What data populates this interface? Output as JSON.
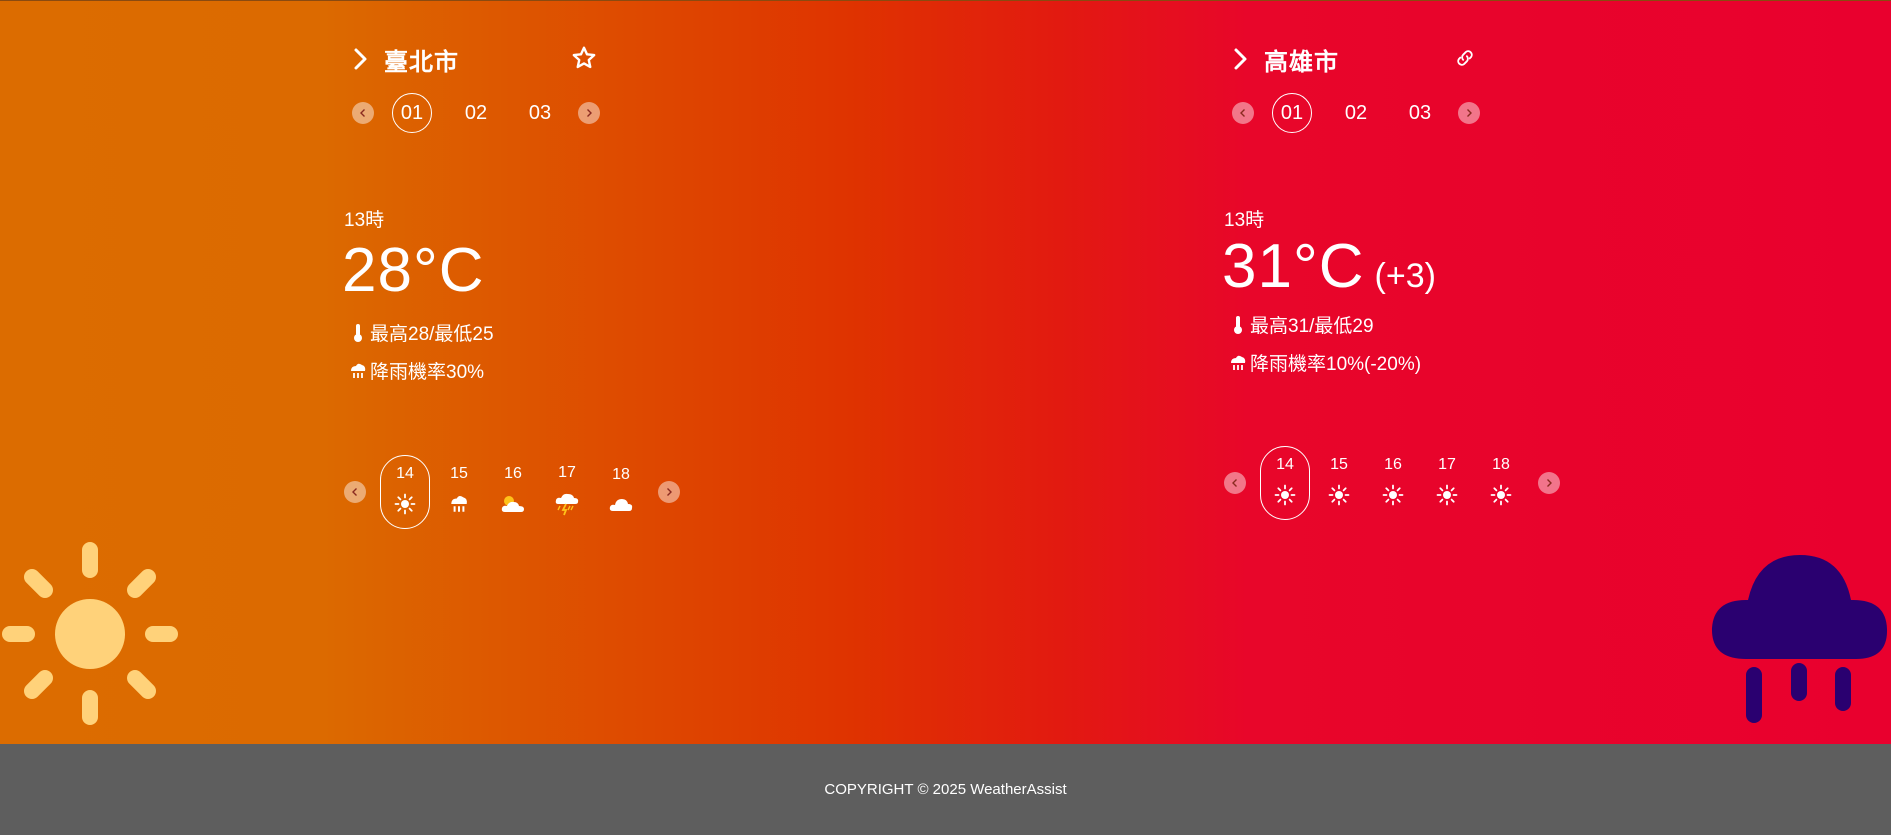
{
  "panels": [
    {
      "city": "臺北市",
      "action_icon": "star-icon",
      "day_tabs": [
        "01",
        "02",
        "03"
      ],
      "active_day": 0,
      "hour": "13時",
      "temperature": "28°C",
      "temp_delta": "",
      "high_low": "最高28/最低25",
      "rain_chance": "降雨機率30%",
      "hourly": [
        {
          "hour": "14",
          "icon": "sunny-icon"
        },
        {
          "hour": "15",
          "icon": "rain-icon"
        },
        {
          "hour": "16",
          "icon": "partly-cloudy-icon"
        },
        {
          "hour": "17",
          "icon": "thunderstorm-icon"
        },
        {
          "hour": "18",
          "icon": "cloudy-icon"
        }
      ],
      "active_hour": 0
    },
    {
      "city": "高雄市",
      "action_icon": "link-icon",
      "day_tabs": [
        "01",
        "02",
        "03"
      ],
      "active_day": 0,
      "hour": "13時",
      "temperature": "31°C",
      "temp_delta": "(+3)",
      "high_low": "最高31/最低29",
      "rain_chance": "降雨機率10%(-20%)",
      "hourly": [
        {
          "hour": "14",
          "icon": "sunny-icon"
        },
        {
          "hour": "15",
          "icon": "sunny-icon"
        },
        {
          "hour": "16",
          "icon": "sunny-icon"
        },
        {
          "hour": "17",
          "icon": "sunny-icon"
        },
        {
          "hour": "18",
          "icon": "sunny-icon"
        }
      ],
      "active_hour": 0
    }
  ],
  "footer": {
    "copyright": "COPYRIGHT © 2025 WeatherAssist"
  },
  "colors": {
    "gradient_start": "#dc6c00",
    "gradient_mid": "#df3300",
    "gradient_end": "#e9002e",
    "footer_bg": "#5e5e5e",
    "sun_deco": "#ffd27a",
    "cloud_deco": "#2a0070"
  },
  "decorations": {
    "left": "sun-decoration-icon",
    "right": "rain-cloud-decoration-icon"
  }
}
